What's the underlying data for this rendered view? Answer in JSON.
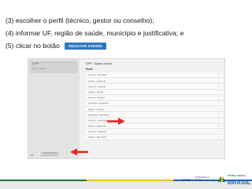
{
  "instructions": {
    "line1": "(3) escolher o perfil (técnico, gestor ou conselho);",
    "line2": "(4) informar UF, região de saúde, município e justificativa; e",
    "line3": "(5) clicar no botão",
    "button_label": "SOLICITAR ACESSO"
  },
  "screenshot": {
    "system_name": "DIPP",
    "system_desc": "Digisus Gestor",
    "panel_title": "DIPP - Digisus Gestor",
    "panel_header": "Perfil",
    "rows": [
      "Técnico - Estadual",
      "Gestor - Regional",
      "Técnico - Federal",
      "Gestor - SESAI",
      "Técnico - SESAI",
      "Conselho - Estadual",
      "Gestor - Federal",
      "Conselho - Municipal",
      "Técnico - Municipal",
      "Gestor - Estadual",
      "Técnico - Regional",
      "Gestor - Municipal"
    ],
    "footer_label": "UF",
    "footer_button": "solicitar acesso"
  },
  "footer": {
    "sus": "SUS",
    "ministerio_line1": "MINISTÉRIO DA",
    "ministerio_line2": "SAÚDE",
    "patria": "PÁTRIA AMADA",
    "brasil": "BRASIL"
  },
  "colors": {
    "button_blue": "#2e77bd",
    "arrow_red": "#e52620",
    "brand_blue": "#1b5fb0",
    "brand_green": "#1a7a3d",
    "brand_yellow": "#f5c400"
  }
}
